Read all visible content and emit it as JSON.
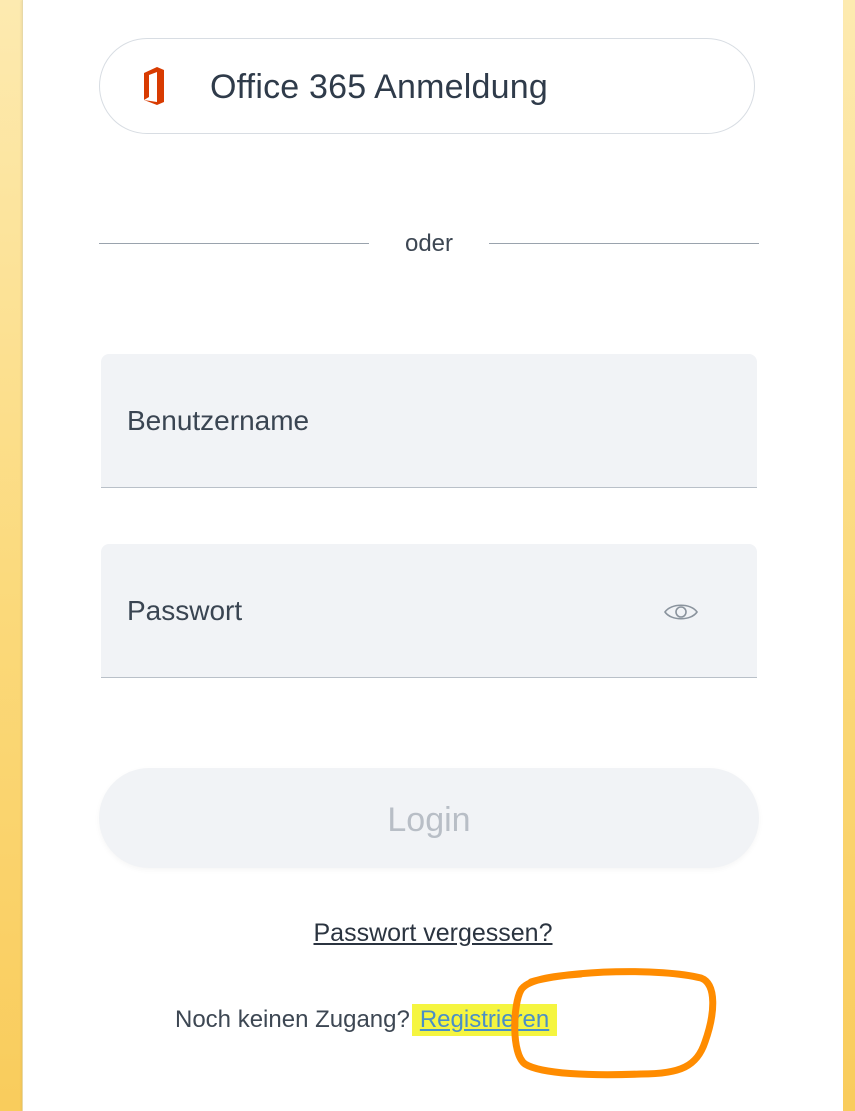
{
  "office_login": {
    "label": "Office 365 Anmeldung",
    "icon": "office-icon",
    "icon_color": "#d83b01"
  },
  "divider": {
    "text": "oder"
  },
  "username": {
    "placeholder": "Benutzername"
  },
  "password": {
    "placeholder": "Passwort",
    "icon": "eye-icon"
  },
  "login_button": {
    "label": "Login"
  },
  "forgot_password": {
    "label": "Passwort vergessen?"
  },
  "register": {
    "question": "Noch keinen Zugang?",
    "link_label": "Registrieren",
    "highlight_color": "#f5f540",
    "annotation_color": "#ff8c00"
  }
}
